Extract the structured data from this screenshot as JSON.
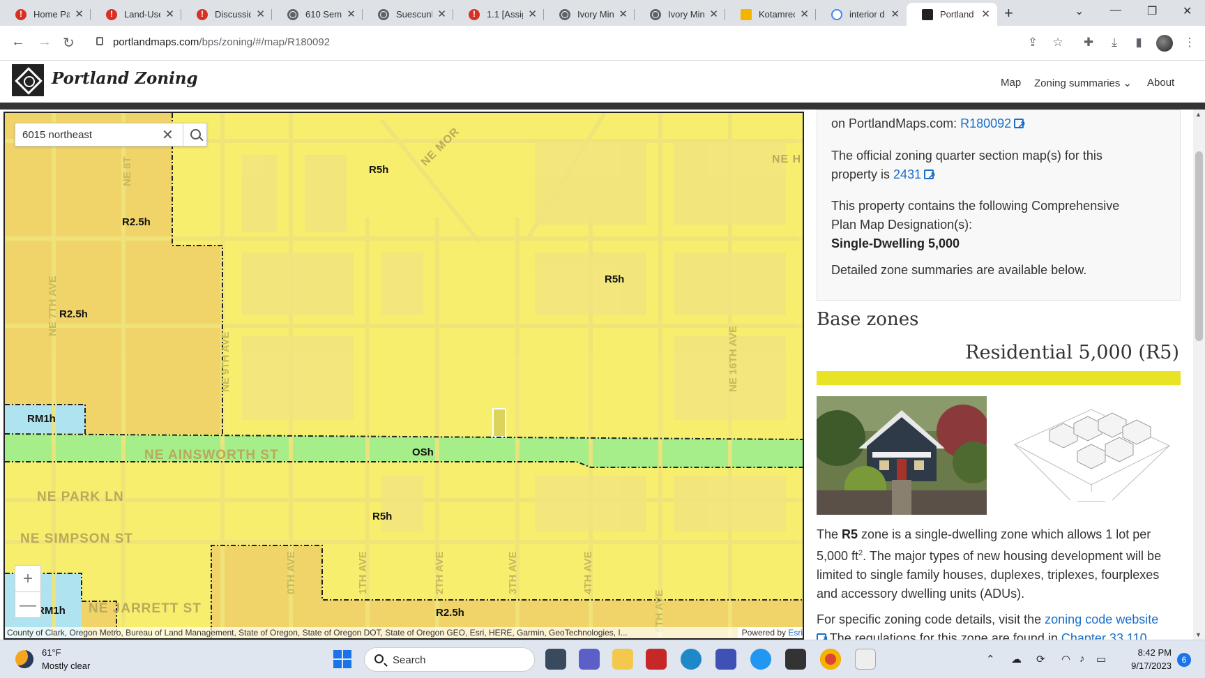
{
  "browser": {
    "tabs": [
      {
        "label": "Home Pa",
        "favicon": "warning-icon"
      },
      {
        "label": "Land-Use",
        "favicon": "warning-icon"
      },
      {
        "label": "Discussio",
        "favicon": "warning-icon"
      },
      {
        "label": "610 Seme",
        "favicon": "globe-icon"
      },
      {
        "label": "Suescunl",
        "favicon": "globe-icon"
      },
      {
        "label": "1.1 [Assig",
        "favicon": "warning-icon"
      },
      {
        "label": "Ivory Min",
        "favicon": "globe-icon"
      },
      {
        "label": "Ivory Min",
        "favicon": "globe-icon"
      },
      {
        "label": "Kotamrec",
        "favicon": "slides-icon"
      },
      {
        "label": "interior d",
        "favicon": "google-icon"
      },
      {
        "label": "Portland",
        "favicon": "portland-icon",
        "active": true
      }
    ],
    "url_host": "portlandmaps.com",
    "url_path": "/bps/zoning/#/map/R180092"
  },
  "site": {
    "title": "Portland Zoning",
    "nav": {
      "map": "Map",
      "summaries": "Zoning summaries ⌄",
      "about": "About"
    }
  },
  "map": {
    "search_value": "6015 northeast",
    "zoom_in": "+",
    "zoom_out": "—",
    "zones": {
      "r5h_top": "R5h",
      "r25h_a": "R2.5h",
      "r25h_b": "R2.5h",
      "r5h_right": "R5h",
      "rm1h_a": "RM1h",
      "osh": "OSh",
      "r5h_bottom": "R5h",
      "rm1h_b": "RM1h",
      "r25h_bottom": "R2.5h"
    },
    "streets": {
      "ainsworth": "NE AINSWORTH ST",
      "park": "NE PARK LN",
      "simpson": "NE SIMPSON ST",
      "jarrett": "NE JARRETT ST",
      "seventh": "NE 7TH AVE",
      "sixteenth": "NE 16TH AVE",
      "eighth": "NE 8T",
      "tenth": "0TH AVE",
      "eleventh": "1TH AVE",
      "twelfth": "2TH AVE",
      "thirteenth": "3TH AVE",
      "fourteenth": "4TH AVE",
      "fifteenth": "5TH AVE",
      "mor": "NE MOR",
      "ne_h": "NE H",
      "ninth": "NE 9TH AVE"
    },
    "attribution": "County of Clark, Oregon Metro, Bureau of Land Management, State of Oregon, State of Oregon DOT, State of Oregon GEO, Esri, HERE, Garmin, GeoTechnologies, I...",
    "powered_prefix": "Powered by ",
    "powered_link": "Esri"
  },
  "panel": {
    "line1_prefix": "on PortlandMaps.com: ",
    "line1_link": "R180092",
    "quarter_text_1": "The official zoning quarter section map(s) for this",
    "quarter_text_2": "property is ",
    "quarter_link": "2431",
    "comp_text_1": "This property contains the following Comprehensive",
    "comp_text_2": "Plan Map Designation(s):",
    "comp_value": "Single-Dwelling 5,000",
    "detailed": "Detailed zone summaries are available below.",
    "base_zones": "Base zones",
    "zone_title": "Residential 5,000 (R5)",
    "zone_color": "#e8e324",
    "desc_1_pre": "The ",
    "desc_1_bold": "R5",
    "desc_1_post": " zone is a single-dwelling zone which allows 1 lot per",
    "desc_2": "5,000 ft",
    "desc_2_sup": "2",
    "desc_2_post": ". The major types of new housing development will be",
    "desc_3": "limited to single family houses, duplexes, triplexes, fourplexes",
    "desc_4": "and accessory dwelling units (ADUs).",
    "specific_pre": "For specific zoning code details, visit the ",
    "specific_link": "zoning code website",
    "regs_pre": "The regulations for this zone are found in ",
    "regs_link": "Chapter 33.110"
  },
  "taskbar": {
    "temp": "61°F",
    "weather": "Mostly clear",
    "search": "Search",
    "time": "8:42 PM",
    "date": "9/17/2023",
    "notifications": "6"
  }
}
